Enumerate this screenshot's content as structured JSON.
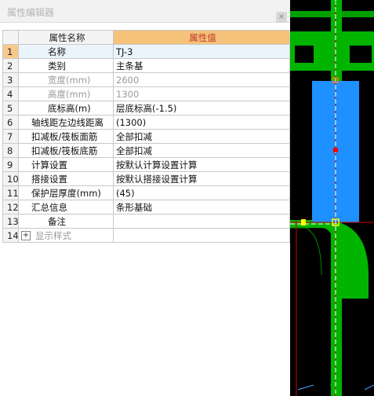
{
  "window": {
    "title": "属性编辑器",
    "close": "×"
  },
  "table": {
    "header_name": "属性名称",
    "header_value": "属性值",
    "rows": [
      {
        "n": "1",
        "name": "名称",
        "value": "TJ-3"
      },
      {
        "n": "2",
        "name": "类别",
        "value": "主条基"
      },
      {
        "n": "3",
        "name": "宽度(mm)",
        "value": "2600"
      },
      {
        "n": "4",
        "name": "高度(mm)",
        "value": "1300"
      },
      {
        "n": "5",
        "name": "底标高(m)",
        "value": "层底标高(-1.5)"
      },
      {
        "n": "6",
        "name": "轴线距左边线距离",
        "value": "(1300)"
      },
      {
        "n": "7",
        "name": "扣减板/筏板面筋",
        "value": "全部扣减"
      },
      {
        "n": "8",
        "name": "扣减板/筏板底筋",
        "value": "全部扣减"
      },
      {
        "n": "9",
        "name": "计算设置",
        "value": "按默认计算设置计算"
      },
      {
        "n": "10",
        "name": "搭接设置",
        "value": "按默认搭接设置计算"
      },
      {
        "n": "11",
        "name": "保护层厚度(mm)",
        "value": "(45)"
      },
      {
        "n": "12",
        "name": "汇总信息",
        "value": "条形基础"
      },
      {
        "n": "13",
        "name": "备注",
        "value": ""
      },
      {
        "n": "14",
        "name": "显示样式",
        "value": "",
        "expander": "+"
      }
    ]
  },
  "colors": {
    "foundation_green": "#00b400",
    "foundation_blue": "#1e90ff",
    "axis_red": "#d40000",
    "background": "#000000"
  }
}
